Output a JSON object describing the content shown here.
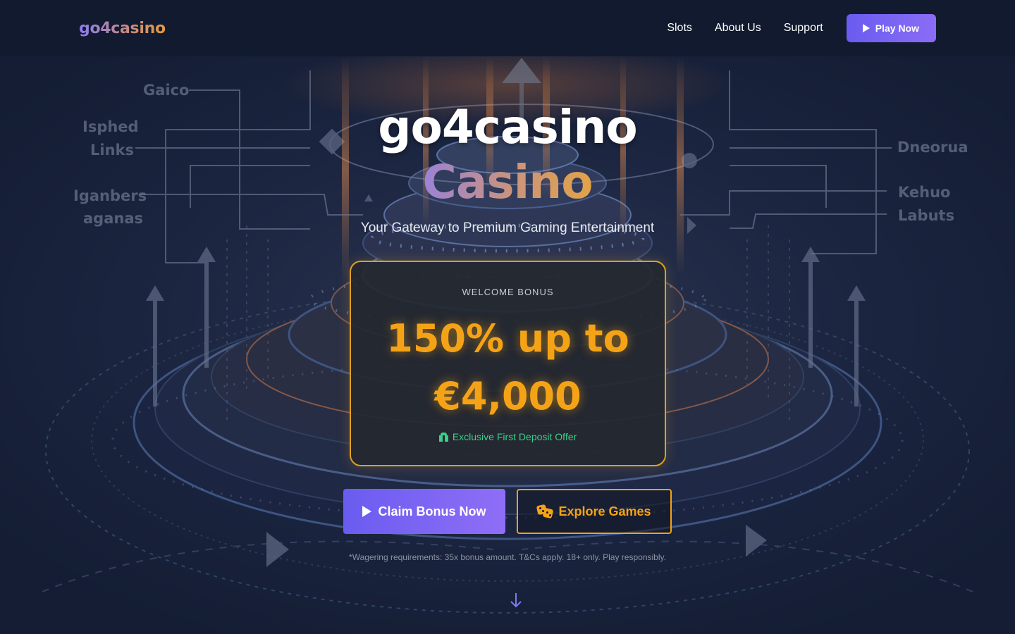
{
  "nav": {
    "logo": "go4casino",
    "links": [
      "Slots",
      "About Us",
      "Support"
    ],
    "cta_label": "Play Now"
  },
  "background": {
    "left_labels": [
      "Gaico",
      "Isphed",
      "Links",
      "Iganbers",
      "aganas"
    ],
    "right_labels": [
      "Dneorua",
      "Kehuo",
      "Labuts"
    ]
  },
  "hero": {
    "title": "go4casino",
    "subtitle": "Casino",
    "tagline": "Your Gateway to Premium Gaming Entertainment"
  },
  "bonus": {
    "label": "WELCOME BONUS",
    "amount_line1": "150% up to",
    "amount_line2": "€4,000",
    "offer": "Exclusive First Deposit Offer"
  },
  "actions": {
    "claim_label": "Claim Bonus Now",
    "explore_label": "Explore Games"
  },
  "disclaimer": "*Wagering requirements: 35x bonus amount. T&Cs apply. 18+ only. Play responsibly.",
  "colors": {
    "accent_purple": "#6a5cf0",
    "accent_gold": "#f5a316",
    "accent_green": "#3ccf8a",
    "nav_bg": "#111a2e"
  },
  "icons": [
    "play-icon",
    "gift-icon",
    "dice-icon",
    "arrow-down-icon"
  ]
}
